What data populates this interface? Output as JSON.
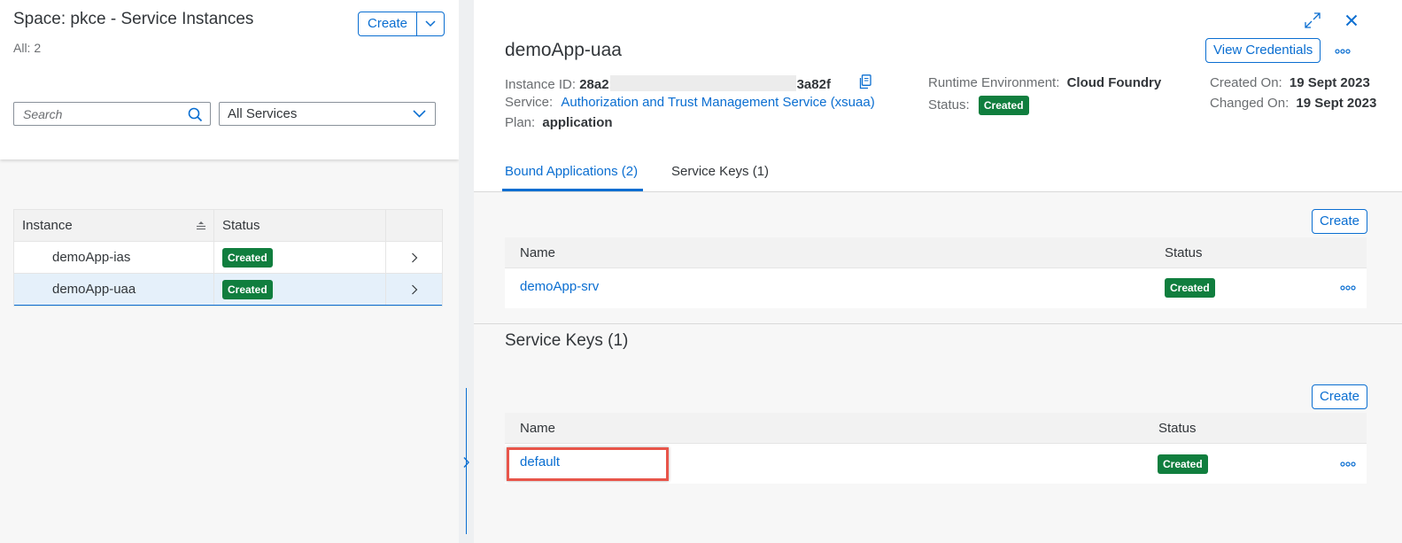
{
  "left_panel": {
    "title": "Space: pkce - Service Instances",
    "count": "All: 2",
    "create_button": "Create",
    "search": {
      "placeholder": "Search"
    },
    "service_filter": "All Services",
    "table": {
      "headers": [
        "Instance",
        "Status"
      ],
      "rows": [
        {
          "name": "demoApp-ias",
          "status": "Created"
        },
        {
          "name": "demoApp-uaa",
          "status": "Created"
        }
      ]
    }
  },
  "detail": {
    "title": "demoApp-uaa",
    "view_credentials": "View Credentials",
    "instance_id_label": "Instance ID:",
    "instance_id_start": "28a2",
    "instance_id_end": "3a82f",
    "service_label": "Service:",
    "service_value": "Authorization and Trust Management Service (xsuaa)",
    "plan_label": "Plan:",
    "plan_value": "application",
    "runtime_label": "Runtime Environment:",
    "runtime_value": "Cloud Foundry",
    "status_label": "Status:",
    "status_value": "Created",
    "created_label": "Created On:",
    "created_value": "19 Sept 2023",
    "changed_label": "Changed On:",
    "changed_value": "19 Sept 2023",
    "tabs": [
      "Bound Applications (2)",
      "Service Keys (1)"
    ],
    "bound_apps": {
      "create_button": "Create",
      "headers": [
        "Name",
        "Status"
      ],
      "rows": [
        {
          "name": "demoApp-srv",
          "status": "Created"
        }
      ]
    },
    "service_keys": {
      "title": "Service Keys (1)",
      "create_button": "Create",
      "headers": [
        "Name",
        "Status"
      ],
      "rows": [
        {
          "name": "default",
          "status": "Created"
        }
      ]
    }
  },
  "colors": {
    "accent": "#0a6ed1",
    "success": "#107e3e",
    "highlight": "#e8554a"
  }
}
